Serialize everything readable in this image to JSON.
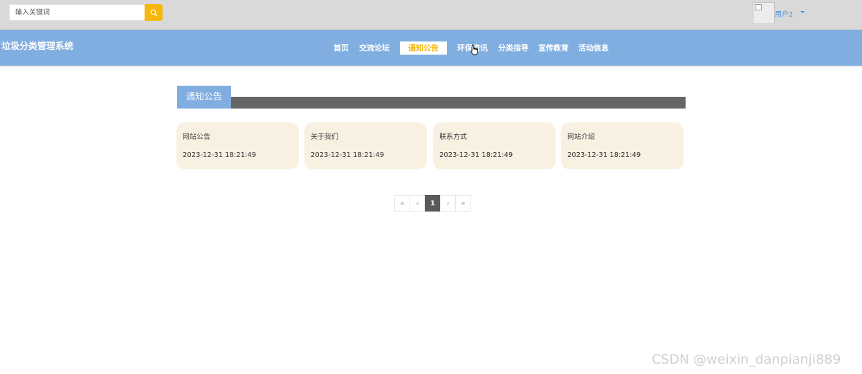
{
  "search": {
    "placeholder": "输入关键词"
  },
  "user": {
    "name": "用户2"
  },
  "site": {
    "title": "垃圾分类管理系统"
  },
  "nav": {
    "items": [
      {
        "label": "首页"
      },
      {
        "label": "交流论坛"
      },
      {
        "label": "通知公告",
        "active": true
      },
      {
        "label": "环保资讯"
      },
      {
        "label": "分类指导"
      },
      {
        "label": "宣传教育"
      },
      {
        "label": "活动信息"
      }
    ]
  },
  "section": {
    "title": "通知公告"
  },
  "cards": [
    {
      "title": "网站公告",
      "date": "2023-12-31 18:21:49"
    },
    {
      "title": "关于我们",
      "date": "2023-12-31 18:21:49"
    },
    {
      "title": "联系方式",
      "date": "2023-12-31 18:21:49"
    },
    {
      "title": "网站介绍",
      "date": "2023-12-31 18:21:49"
    }
  ],
  "pagination": {
    "first": "«",
    "prev": "‹",
    "current": "1",
    "next": "›",
    "last": "»"
  },
  "watermark": "CSDN @weixin_danpianji889",
  "colors": {
    "accent": "#f6b70d",
    "nav_bg": "#80aee0",
    "card_bg": "#f8f1e2",
    "section_bar": "#666666"
  }
}
